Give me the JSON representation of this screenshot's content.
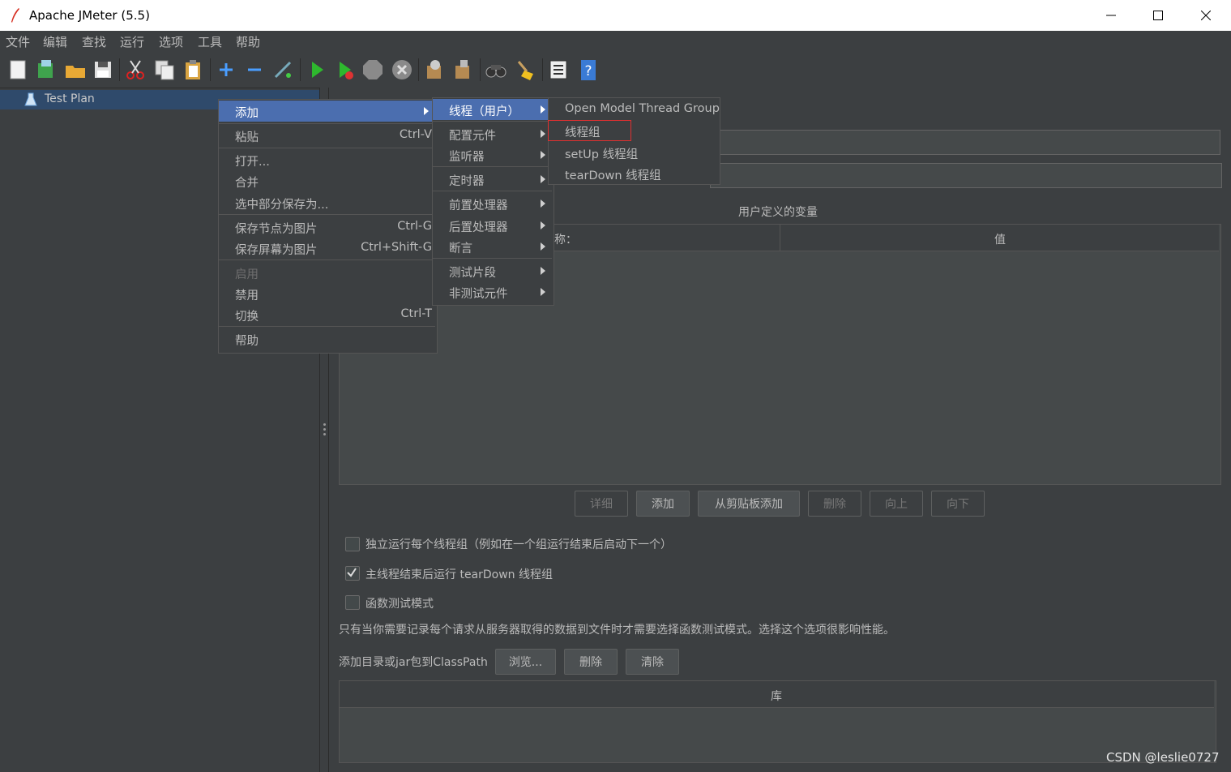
{
  "window": {
    "title": "Apache JMeter (5.5)"
  },
  "menubar": [
    "文件",
    "编辑",
    "查找",
    "运行",
    "选项",
    "工具",
    "帮助"
  ],
  "tree": {
    "root": "Test Plan"
  },
  "context_menu": {
    "add": "添加",
    "paste": "粘贴",
    "paste_sc": "Ctrl-V",
    "open": "打开...",
    "merge": "合并",
    "save_selection": "选中部分保存为...",
    "save_node_img": "保存节点为图片",
    "save_node_img_sc": "Ctrl-G",
    "save_screen_img": "保存屏幕为图片",
    "save_screen_img_sc": "Ctrl+Shift-G",
    "enable": "启用",
    "disable": "禁用",
    "toggle": "切换",
    "toggle_sc": "Ctrl-T",
    "help": "帮助"
  },
  "submenu_add": {
    "threads": "线程（用户）",
    "config": "配置元件",
    "listener": "监听器",
    "timer": "定时器",
    "pre": "前置处理器",
    "post": "后置处理器",
    "assertion": "断言",
    "fragment": "测试片段",
    "non_test": "非测试元件"
  },
  "submenu_threads": {
    "open_model": "Open Model Thread Group",
    "thread_group": "线程组",
    "setup": "setUp 线程组",
    "teardown": "tearDown 线程组"
  },
  "editor": {
    "udv_title": "用户定义的变量",
    "col_name": "称：",
    "col_value": "值",
    "btn_detail": "详细",
    "btn_add": "添加",
    "btn_add_clip": "从剪贴板添加",
    "btn_delete": "删除",
    "btn_up": "向上",
    "btn_down": "向下",
    "chk_serial": "独立运行每个线程组（例如在一个组运行结束后启动下一个）",
    "chk_teardown": "主线程结束后运行 tearDown 线程组",
    "chk_functional": "函数测试模式",
    "functional_note": "只有当你需要记录每个请求从服务器取得的数据到文件时才需要选择函数测试模式。选择这个选项很影响性能。",
    "classpath_label": "添加目录或jar包到ClassPath",
    "btn_browse": "浏览...",
    "btn_cp_delete": "删除",
    "btn_cp_clear": "清除",
    "lib_header": "库"
  },
  "watermark": "CSDN @leslie0727"
}
